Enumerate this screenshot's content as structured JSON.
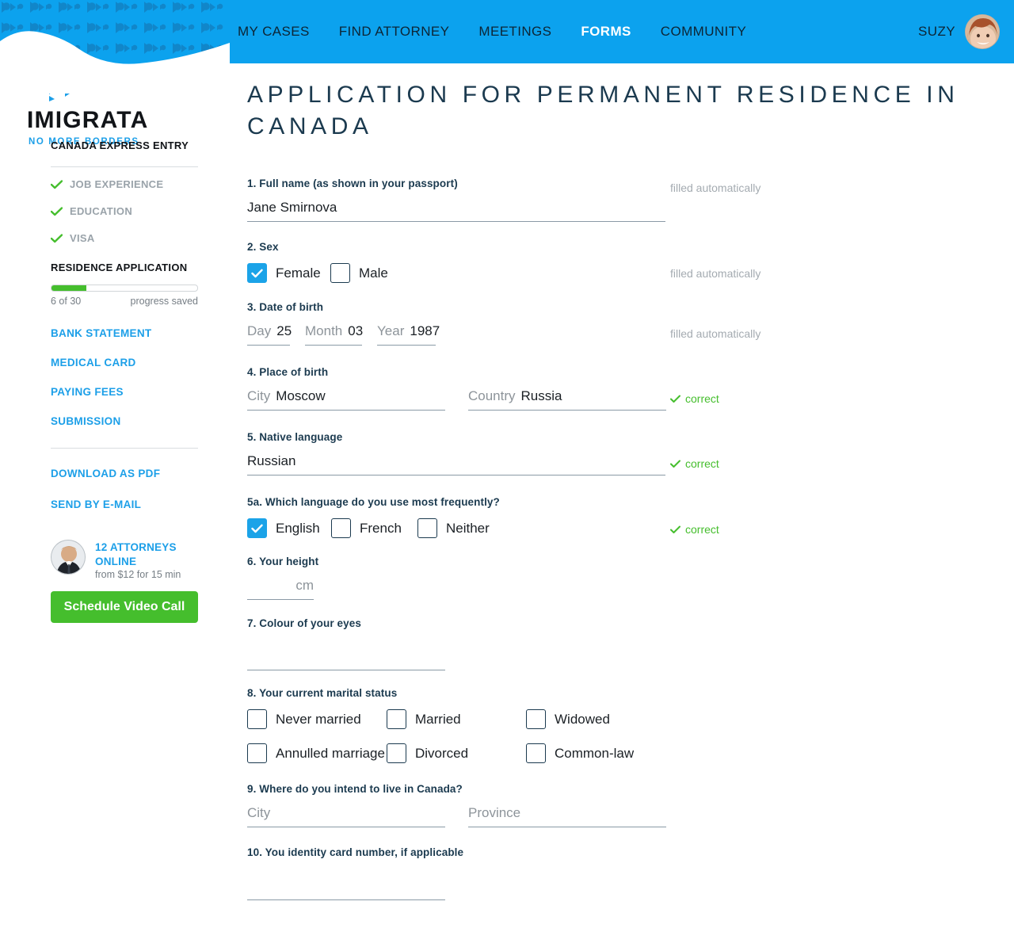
{
  "colors": {
    "brand_blue": "#1C9FE8",
    "header_blue": "#0CA2EE",
    "green": "#45BE2D",
    "title_slate": "#1b3a4f",
    "muted_gray": "#9AA3AA"
  },
  "topnav": {
    "items": [
      {
        "label": "MY CASES",
        "active": false
      },
      {
        "label": "FIND ATTORNEY",
        "active": false
      },
      {
        "label": "MEETINGS",
        "active": false
      },
      {
        "label": "FORMS",
        "active": true
      },
      {
        "label": "COMMUNITY",
        "active": false
      }
    ],
    "user_name": "SUZY"
  },
  "brand": {
    "name": "IMIGRATA",
    "tagline": "NO MORE BORDERS"
  },
  "sidebar": {
    "section_title": "CANADA EXPRESS ENTRY",
    "completed_steps": [
      {
        "label": "JOB EXPERIENCE"
      },
      {
        "label": "EDUCATION"
      },
      {
        "label": "VISA"
      }
    ],
    "current_section_title": "RESIDENCE APPLICATION",
    "progress": {
      "percent": 24,
      "count_label": "6 of 30",
      "saved_label": "progress saved"
    },
    "doc_links": [
      {
        "label": "BANK STATEMENT"
      },
      {
        "label": "MEDICAL CARD"
      },
      {
        "label": "PAYING FEES"
      },
      {
        "label": "SUBMISSION"
      }
    ],
    "action_links": [
      {
        "label": "DOWNLOAD AS PDF"
      },
      {
        "label": "SEND BY E-MAIL"
      }
    ],
    "attorneys": {
      "headline": "12 ATTORNEYS ONLINE",
      "price": "from $12 for 15 min",
      "cta": "Schedule Video Call"
    }
  },
  "main": {
    "page_title": "Application for permanent residence in Canada",
    "status_filled": "filled automatically",
    "status_correct": "correct",
    "questions": {
      "q1": {
        "label": "1. Full name (as shown in your passport)",
        "value": "Jane Smirnova",
        "status": "filled automatically"
      },
      "q2": {
        "label": "2. Sex",
        "options": [
          {
            "label": "Female",
            "checked": true
          },
          {
            "label": "Male",
            "checked": false
          }
        ],
        "status": "filled automatically"
      },
      "q3": {
        "label": "3. Date of birth",
        "day_placeholder": "Day",
        "day_value": "25",
        "month_placeholder": "Month",
        "month_value": "03",
        "year_placeholder": "Year",
        "year_value": "1987",
        "status": "filled automatically"
      },
      "q4": {
        "label": "4. Place of birth",
        "city_placeholder": "City",
        "city_value": "Moscow",
        "country_placeholder": "Country",
        "country_value": "Russia",
        "status": "correct"
      },
      "q5": {
        "label": "5. Native language",
        "value": "Russian",
        "status": "correct"
      },
      "q5a": {
        "label": "5a. Which language do you use most frequently?",
        "options": [
          {
            "label": "English",
            "checked": true
          },
          {
            "label": "French",
            "checked": false
          },
          {
            "label": "Neither",
            "checked": false
          }
        ],
        "status": "correct"
      },
      "q6": {
        "label": "6. Your height",
        "value": "",
        "unit": "cm"
      },
      "q7": {
        "label": "7. Colour of your eyes",
        "value": ""
      },
      "q8": {
        "label": "8. Your current marital status",
        "options": [
          {
            "label": "Never married",
            "checked": false
          },
          {
            "label": "Married",
            "checked": false
          },
          {
            "label": "Widowed",
            "checked": false
          },
          {
            "label": "Annulled marriage",
            "checked": false
          },
          {
            "label": "Divorced",
            "checked": false
          },
          {
            "label": "Common-law",
            "checked": false
          }
        ]
      },
      "q9": {
        "label": "9. Where do you intend to live in Canada?",
        "city_placeholder": "City",
        "city_value": "",
        "province_placeholder": "Province",
        "province_value": ""
      },
      "q10": {
        "label": "10. You identity card number, if applicable",
        "value": ""
      }
    }
  }
}
